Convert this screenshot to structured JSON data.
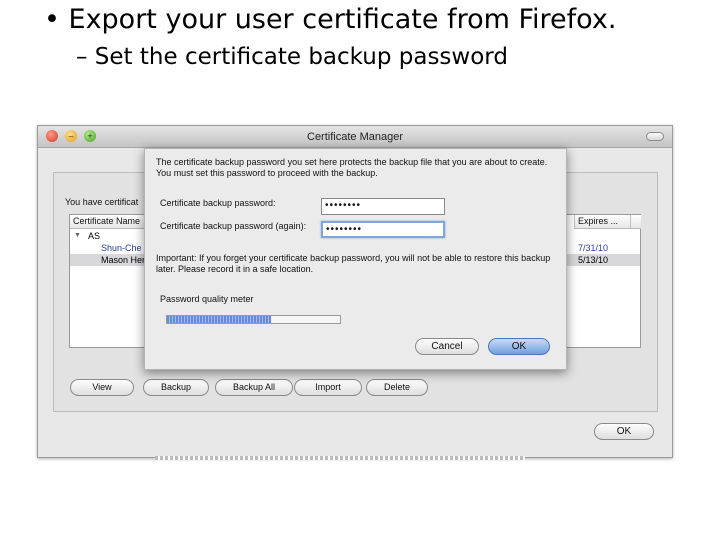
{
  "slide": {
    "bullet": "• Export your user certificate from Firefox.",
    "subbullet": "– Set the certificate backup password"
  },
  "window": {
    "title": "Certificate Manager",
    "info_text": "You have certificat",
    "table": {
      "headers": {
        "name": "Certificate Name",
        "expires": "Expires ..."
      },
      "group": "AS",
      "rows": [
        {
          "name": "Shun-Che",
          "expires": "7/31/10"
        },
        {
          "name": "Mason Her",
          "expires": "5/13/10"
        }
      ]
    },
    "buttons": {
      "view": "View",
      "backup": "Backup",
      "backup_all": "Backup All",
      "import": "Import",
      "delete": "Delete",
      "ok": "OK"
    }
  },
  "sheet": {
    "intro": "The certificate backup password you set here protects the backup file that you are about to create. You must set this password to proceed with the backup.",
    "password_label": "Certificate backup password:",
    "password_value": "••••••••",
    "password_again_label": "Certificate backup password (again):",
    "password_again_value": "••••••••",
    "important": "Important: If you forget your certificate backup password, you will not be able to restore this backup later. Please record it in a safe location.",
    "meter_label": "Password quality meter",
    "meter_fraction": 0.6,
    "cancel_label": "Cancel",
    "ok_label": "OK"
  },
  "colors": {
    "accent": "#6f9fe0",
    "meter": "#5f8ed6"
  },
  "icons": {
    "close": "close-icon",
    "minimize": "minimize-icon",
    "zoom": "zoom-icon",
    "column_picker": "column-picker-icon",
    "expand": "disclosure-triangle-icon"
  }
}
